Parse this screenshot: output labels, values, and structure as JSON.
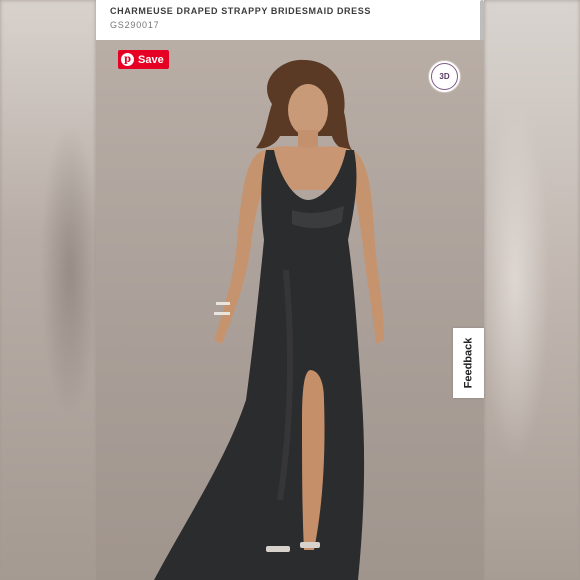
{
  "product": {
    "title": "CHARMEUSE DRAPED STRAPPY BRIDESMAID DRESS",
    "sku": "GS290017"
  },
  "pinterest": {
    "label": "Save",
    "icon": "pinterest-icon",
    "color": "#e60023"
  },
  "viewer": {
    "label_3d": "3D",
    "icon": "3d-view-icon"
  },
  "feedback": {
    "label": "Feedback"
  },
  "colors": {
    "background": "#a39a93",
    "dress": "#2b2c2d",
    "accent_3d": "#7d5a86"
  }
}
